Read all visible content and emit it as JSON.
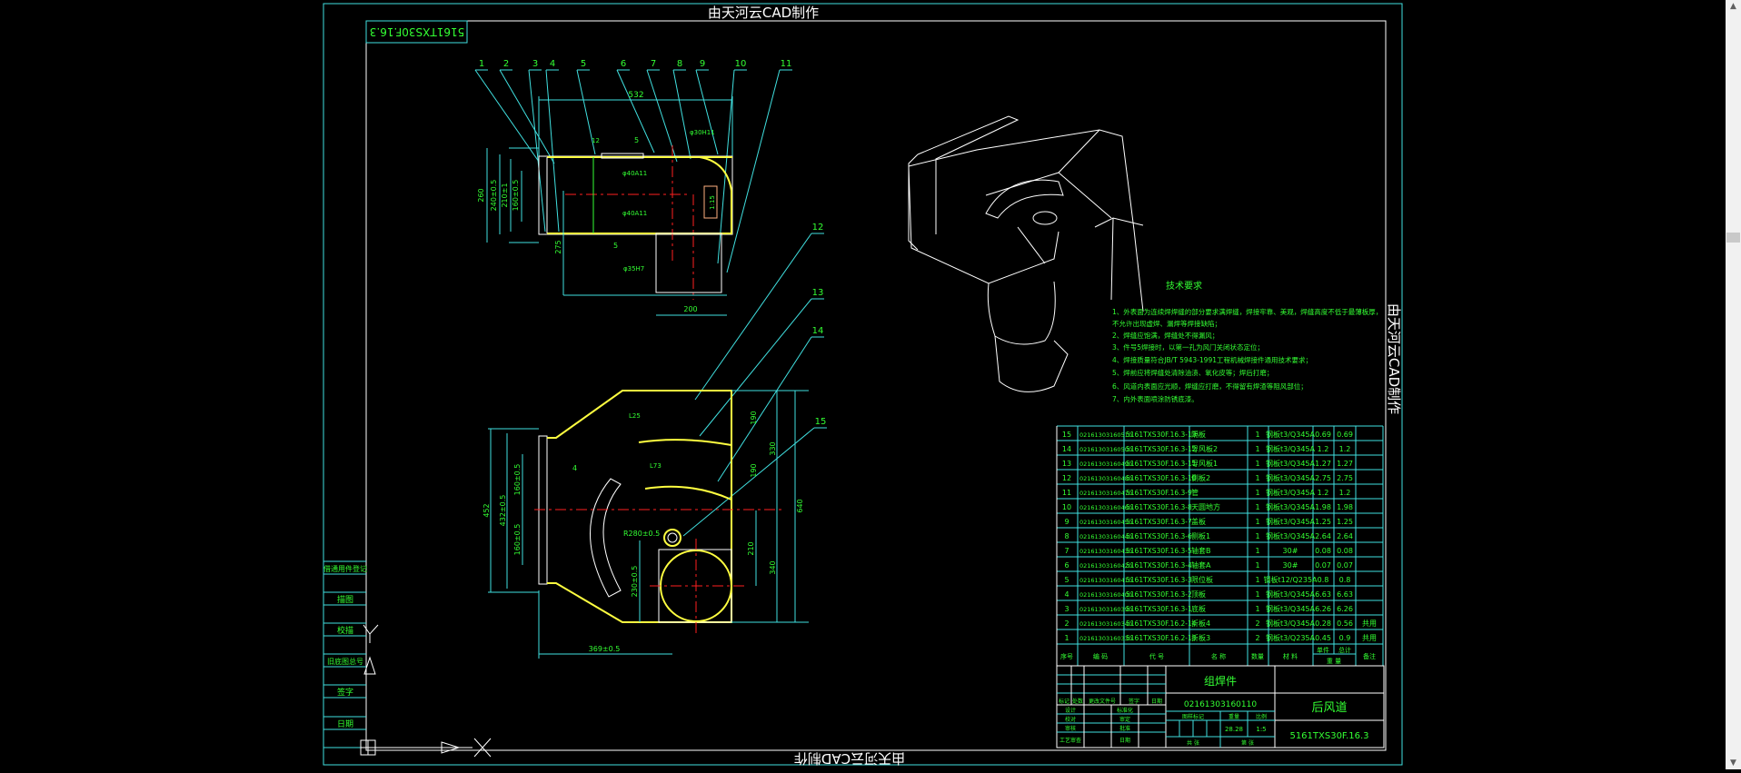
{
  "watermark": {
    "top": "由天河云CAD制作",
    "bottom": "由天河云CAD制作",
    "right": "由天河云CAD制作"
  },
  "stamp": "5161TXS30F.16.3",
  "callouts": [
    "1",
    "2",
    "3",
    "4",
    "5",
    "6",
    "7",
    "8",
    "9",
    "10",
    "11",
    "12",
    "13",
    "14",
    "15"
  ],
  "dimensions": {
    "top_view": [
      "532",
      "260",
      "240±0.5",
      "210±1",
      "160±0.5",
      "275",
      "200",
      "φ40A11",
      "φ40A11",
      "φ35H7",
      "φ30H11",
      "12",
      "1:15",
      "5",
      "5"
    ],
    "bottom_view": [
      "452",
      "432±0.5",
      "160±0.5",
      "160±0.5",
      "369±0.5",
      "230±0.5",
      "R280±0.5",
      "640",
      "330",
      "190",
      "190",
      "210",
      "340",
      "L25",
      "L73",
      "4"
    ]
  },
  "tech_requirements": {
    "title": "技术要求",
    "items": [
      "1、外表面为连续焊焊缝的部分要求满焊缝，焊接牢靠、美观，焊缝高度不低于最薄板厚，",
      "   不允许出现虚焊、漏焊等焊接缺陷；",
      "2、焊缝应饱满，焊缝处不得漏风；",
      "3、件号5焊接时，以第一孔为风门关闭状态定位；",
      "4、焊接质量符合JB/T 5943-1991工程机械焊接件通用技术要求；",
      "5、焊前应将焊缝处清除油渍、氧化皮等；焊后打磨；",
      "6、风道内表面应光顺，焊缝应打磨，不得留有焊渣等阻风部位；",
      "7、内外表面喷涂防锈底漆。"
    ]
  },
  "bom": {
    "headers": [
      "序号",
      "编  码",
      "代  号",
      "名  称",
      "数量",
      "材  料",
      "单件",
      "总计",
      "重  量",
      "备注"
    ],
    "rows": [
      [
        "15",
        "02161303160510",
        "5161TXS30F.16.3-13",
        "隔板",
        "1",
        "钢板t3/Q345A",
        "0.69",
        "0.69",
        ""
      ],
      [
        "14",
        "02161303160500",
        "5161TXS30F.16.3-12",
        "导风板2",
        "1",
        "钢板t3/Q345A",
        "1.2",
        "1.2",
        ""
      ],
      [
        "13",
        "02161303160490",
        "5161TXS30F.16.3-11",
        "导风板1",
        "1",
        "钢板t3/Q345A",
        "1.27",
        "1.27",
        ""
      ],
      [
        "12",
        "02161303160480",
        "5161TXS30F.16.3-10",
        "侧板2",
        "1",
        "钢板t3/Q345A",
        "2.75",
        "2.75",
        ""
      ],
      [
        "11",
        "02161303160470",
        "5161TXS30F.16.3-9",
        "管",
        "1",
        "钢板t3/Q345A",
        "1.2",
        "1.2",
        ""
      ],
      [
        "10",
        "02161303160460",
        "5161TXS30F.16.3-8",
        "天圆地方",
        "1",
        "钢板t3/Q345A",
        "1.98",
        "1.98",
        ""
      ],
      [
        "9",
        "02161303160450",
        "5161TXS30F.16.3-7",
        "盖板",
        "1",
        "钢板t3/Q345A",
        "1.25",
        "1.25",
        ""
      ],
      [
        "8",
        "02161303160440",
        "5161TXS30F.16.3-6",
        "侧板1",
        "1",
        "钢板t3/Q345A",
        "2.64",
        "2.64",
        ""
      ],
      [
        "7",
        "02161303160430",
        "5161TXS30F.16.3-5",
        "轴套B",
        "1",
        "30#",
        "0.08",
        "0.08",
        ""
      ],
      [
        "6",
        "02161303160420",
        "5161TXS30F.16.3-4",
        "轴套A",
        "1",
        "30#",
        "0.07",
        "0.07",
        ""
      ],
      [
        "5",
        "02161303160410",
        "5161TXS30F.16.3-3",
        "限位板",
        "1",
        "钢板t12/Q235A",
        "0.8",
        "0.8",
        ""
      ],
      [
        "4",
        "02161303160400",
        "5161TXS30F.16.3-2",
        "顶板",
        "1",
        "钢板t3/Q345A",
        "6.63",
        "6.63",
        ""
      ],
      [
        "3",
        "02161303160390",
        "5161TXS30F.16.3-1",
        "底板",
        "1",
        "钢板t3/Q345A",
        "6.26",
        "6.26",
        ""
      ],
      [
        "2",
        "02161303160340",
        "5161TXS30F.16.2-14",
        "折板4",
        "2",
        "钢板t3/Q345A",
        "0.28",
        "0.56",
        "共用"
      ],
      [
        "1",
        "02161303160330",
        "5161TXS30F.16.2-13",
        "折板3",
        "2",
        "钢板t3/Q235A",
        "0.45",
        "0.9",
        "共用"
      ]
    ]
  },
  "title_block": {
    "assembly_type": "组焊件",
    "code": "02161303160110",
    "part_name": "后风道",
    "drawing_number": "5161TXS30F.16.3",
    "weight": "28.28",
    "scale": "1:5",
    "labels": {
      "mark": "标记",
      "count": "处数",
      "change_doc": "更改文件号",
      "sign": "签字",
      "date": "日期",
      "design": "设计",
      "standard": "标准化",
      "check": "校对",
      "review": "审定",
      "audit": "审核",
      "approve": "批准",
      "process": "工艺审查",
      "date2": "日期",
      "drawing_mark": "图样标记",
      "weight_label": "重量",
      "scale_label": "比例",
      "sheets_total": "共   张",
      "sheet_no": "第   张"
    }
  },
  "left_sidebar": [
    "借通用件登记",
    "描图",
    "校描",
    "旧底图总号",
    "签字",
    "日期"
  ],
  "colors": {
    "frame": "#40e0e0",
    "text": "#33ff33",
    "outline": "#ffff40",
    "centerline": "#ff2020",
    "background": "#000000"
  }
}
